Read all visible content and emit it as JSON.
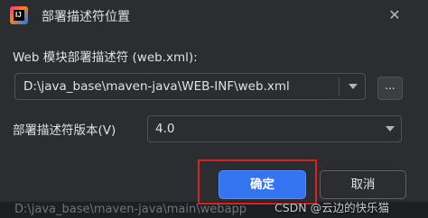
{
  "dialog": {
    "title": "部署描述符位置",
    "descriptor_label": "Web 模块部署描述符 (web.xml):",
    "descriptor_path": "D:\\java_base\\maven-java\\WEB-INF\\web.xml",
    "browse_label": "...",
    "version_label": "部署描述符版本(V)",
    "version_value": "4.0",
    "ok_label": "确定",
    "cancel_label": "取消"
  },
  "background": {
    "partial_text": "D:\\java_base\\maven-java\\main\\webapp"
  },
  "watermark": "CSDN @云边的快乐猫",
  "colors": {
    "accent": "#3574f0",
    "highlight": "#d62424",
    "background": "#2b2d30"
  },
  "icons": {
    "app": "intellij-idea-icon",
    "close": "close-icon"
  }
}
